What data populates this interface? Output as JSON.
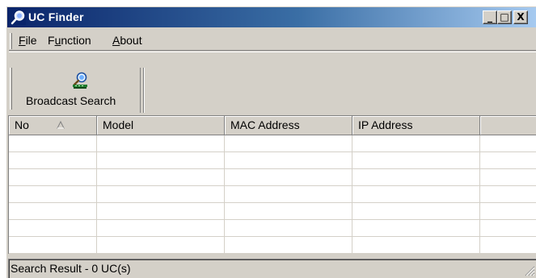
{
  "window": {
    "title": "UC Finder",
    "controls": {
      "minimize": "_",
      "maximize": "□",
      "close": "X"
    }
  },
  "menu": {
    "items": [
      {
        "label": "File",
        "accel": "F",
        "rest": "ile"
      },
      {
        "label": "Function",
        "pre": "F",
        "accel": "u",
        "rest": "nction"
      },
      {
        "label": "About",
        "accel": "A",
        "rest": "bout"
      }
    ]
  },
  "toolbar": {
    "broadcast_search": {
      "label": "Broadcast Search",
      "icon": "search-magnifier-network-icon"
    }
  },
  "list": {
    "columns": [
      "No",
      "Model",
      "MAC Address",
      "IP Address",
      ""
    ],
    "sort_column": "No",
    "sort_icon": "sort-ascending-arrow-icon",
    "rows": []
  },
  "status": {
    "text": "Search Result -  0 UC(s)"
  },
  "colors": {
    "title_bar_start": "#0a246a",
    "title_bar_end": "#a6caf0",
    "face": "#d4d0c8"
  }
}
